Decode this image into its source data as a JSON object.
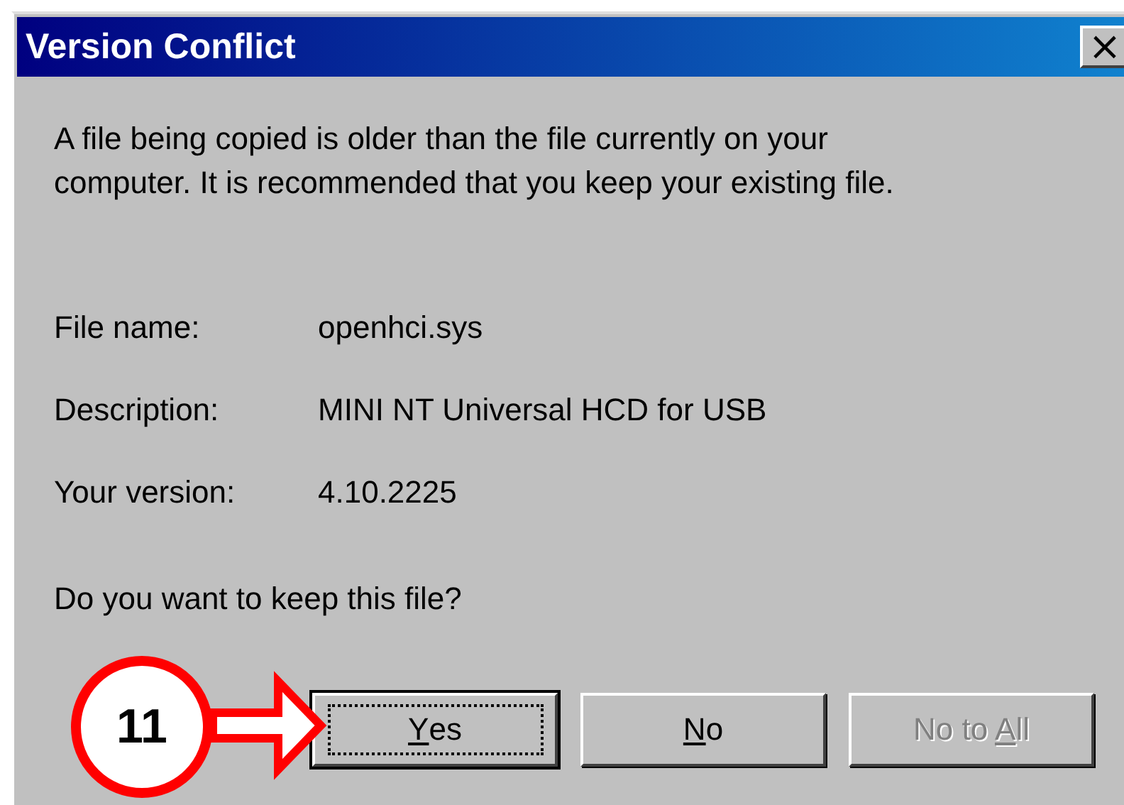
{
  "window": {
    "title": "Version Conflict",
    "close_label": "×"
  },
  "message": "A file being copied is older than the file currently on your computer. It is recommended that you keep your existing file.",
  "fields": [
    {
      "label": "File name:",
      "value": "openhci.sys"
    },
    {
      "label": "Description:",
      "value": "MINI NT Universal HCD for USB"
    },
    {
      "label": "Your version:",
      "value": "4.10.2225"
    }
  ],
  "question": "Do you want to keep this file?",
  "buttons": [
    {
      "access": "Y",
      "after": "es",
      "default": true,
      "disabled": false
    },
    {
      "access": "N",
      "after": "o",
      "default": false,
      "disabled": false
    },
    {
      "before": "No to ",
      "access": "A",
      "after": "ll",
      "default": false,
      "disabled": true
    }
  ],
  "callout": {
    "number": "11"
  }
}
